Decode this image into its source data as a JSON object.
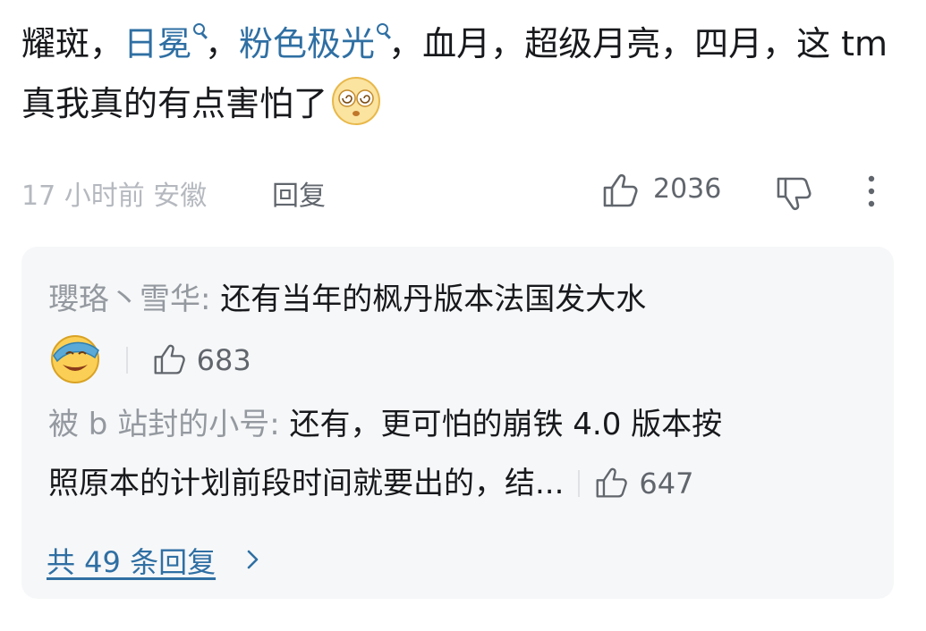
{
  "comment": {
    "text_a": "耀斑，",
    "kw1": "日冕",
    "text_b": "，",
    "kw2": "粉色极光",
    "text_c": "，血月，超级月亮，四月，这 tm 真我真的有点害怕了",
    "emoji": "dizzy-face-emoji",
    "time_location": "17 小时前 安徽",
    "reply_label": "回复",
    "like_count": "2036"
  },
  "replies": [
    {
      "user": "瓔珞丶雪华",
      "sep": ": ",
      "text": "还有当年的枫丹版本法国发大水",
      "emoji": "grinning-hand-over-face-emoji",
      "likes": "683"
    },
    {
      "user": "被 b 站封的小号",
      "sep": ": ",
      "text1": "还有，更可怕的崩铁 4.0 版本按",
      "text2": "照原本的计划前段时间就要出的，结...",
      "likes": "647"
    }
  ],
  "view_all": "共 49 条回复",
  "colors": {
    "link": "#2f6fa3",
    "muted": "#9499a0",
    "bg_reply": "#f6f7f8"
  }
}
